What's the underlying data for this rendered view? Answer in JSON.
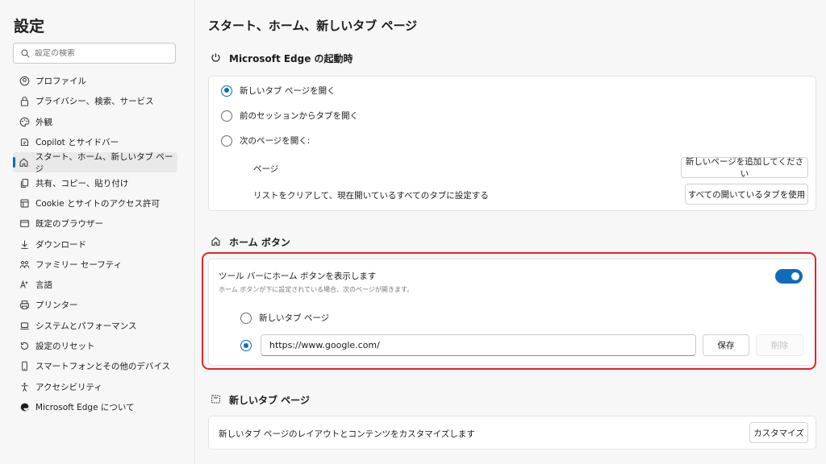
{
  "sidebar": {
    "title": "設定",
    "search_placeholder": "設定の検索",
    "items": [
      {
        "label": "プロファイル",
        "icon": "profile-icon"
      },
      {
        "label": "プライバシー、検索、サービス",
        "icon": "lock-icon"
      },
      {
        "label": "外観",
        "icon": "palette-icon"
      },
      {
        "label": "Copilot とサイドバー",
        "icon": "copilot-icon"
      },
      {
        "label": "スタート、ホーム、新しいタブ ページ",
        "icon": "home-icon",
        "active": true
      },
      {
        "label": "共有、コピー、貼り付け",
        "icon": "share-icon"
      },
      {
        "label": "Cookie とサイトのアクセス許可",
        "icon": "cookie-icon"
      },
      {
        "label": "既定のブラウザー",
        "icon": "browser-icon"
      },
      {
        "label": "ダウンロード",
        "icon": "download-icon"
      },
      {
        "label": "ファミリー セーフティ",
        "icon": "family-icon"
      },
      {
        "label": "言語",
        "icon": "language-icon"
      },
      {
        "label": "プリンター",
        "icon": "printer-icon"
      },
      {
        "label": "システムとパフォーマンス",
        "icon": "laptop-icon"
      },
      {
        "label": "設定のリセット",
        "icon": "reset-icon"
      },
      {
        "label": "スマートフォンとその他のデバイス",
        "icon": "phone-icon"
      },
      {
        "label": "アクセシビリティ",
        "icon": "accessibility-icon"
      },
      {
        "label": "Microsoft Edge について",
        "icon": "edge-logo-icon"
      }
    ]
  },
  "main": {
    "title": "スタート、ホーム、新しいタブ ページ",
    "startup": {
      "heading": "Microsoft Edge の起動時",
      "option_new_tab": "新しいタブ ページを開く",
      "option_previous": "前のセッションからタブを開く",
      "option_pages": "次のページを開く:",
      "pages_label": "ページ",
      "add_page_button": "新しいページを追加してください",
      "clear_label": "リストをクリアして、現在開いているすべてのタブに設定する",
      "use_all_tabs_button": "すべての開いているタブを使用"
    },
    "home": {
      "heading": "ホーム ボタン",
      "show_label": "ツール バーにホーム ボタンを表示します",
      "show_sublabel": "ホーム ボタンが下に設定されている場合、次のページが開きます。",
      "toggle_on": true,
      "option_new_tab": "新しいタブ ページ",
      "url_value": "https://www.google.com/",
      "save_button": "保存",
      "delete_button": "削除"
    },
    "newtab": {
      "heading": "新しいタブ ページ",
      "customize_label": "新しいタブ ページのレイアウトとコンテンツをカスタマイズします",
      "customize_button": "カスタマイズ"
    }
  },
  "colors": {
    "accent": "#0f6cbd",
    "highlight": "#e4232a"
  }
}
